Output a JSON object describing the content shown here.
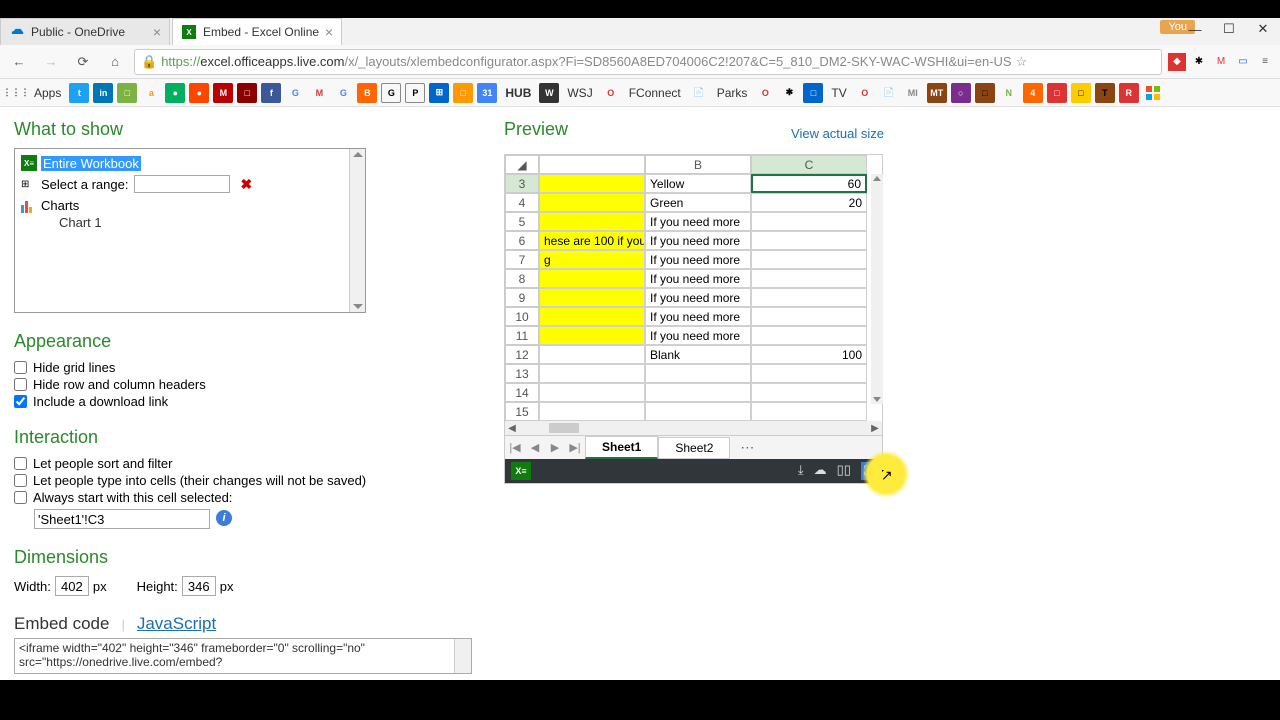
{
  "tabs": [
    {
      "title": "Public - OneDrive",
      "icon_color": "#0078d4"
    },
    {
      "title": "Embed - Excel Online",
      "icon_color": "#107c10"
    }
  ],
  "you_label": "You",
  "url": {
    "scheme": "https://",
    "host": "excel.officeapps.live.com",
    "path": "/x/_layouts/xlembedconfigurator.aspx?Fi=SD8560A8ED704006C2!207&C=5_810_DM2-SKY-WAC-WSHI&ui=en-US"
  },
  "bookmarks": [
    "Apps",
    "t",
    "in",
    "",
    "a",
    "",
    "",
    "M",
    "",
    "G",
    "G",
    "",
    "P",
    "",
    "",
    "31",
    "HUB",
    "W",
    "WSJ",
    "",
    "FConnect",
    "",
    "Parks",
    "O",
    "",
    "",
    "TV",
    "O",
    "",
    "MI",
    "MT",
    "",
    "",
    "N",
    "4",
    "",
    "",
    "",
    "",
    "R",
    ""
  ],
  "sections": {
    "what": "What to show",
    "appearance": "Appearance",
    "interaction": "Interaction",
    "dimensions": "Dimensions",
    "embed": "Embed code",
    "js": "JavaScript",
    "preview": "Preview"
  },
  "what_items": {
    "workbook": "Entire Workbook",
    "range_label": "Select a range:",
    "charts": "Charts",
    "chart1": "Chart 1"
  },
  "appearance_items": {
    "grid": "Hide grid lines",
    "headers": "Hide row and column headers",
    "download": "Include a download link"
  },
  "interaction_items": {
    "sort": "Let people sort and filter",
    "type": "Let people type into cells (their changes will not be saved)",
    "start": "Always start with this cell selected:",
    "cell_value": "'Sheet1'!C3"
  },
  "dimensions_items": {
    "width_label": "Width:",
    "width_value": "402",
    "height_label": "Height:",
    "height_value": "346",
    "px": "px"
  },
  "embed_code": "<iframe width=\"402\" height=\"346\" frameborder=\"0\" scrolling=\"no\" src=\"https://onedrive.live.com/embed?",
  "view_actual": "View actual size",
  "sheet_cols": [
    "",
    "B",
    "C"
  ],
  "chart_data": {
    "type": "table",
    "columns": [
      "row",
      "A_fragment",
      "B",
      "C"
    ],
    "rows": [
      {
        "row": 3,
        "A_fragment": "",
        "B": "Yellow",
        "C": 60
      },
      {
        "row": 4,
        "A_fragment": "",
        "B": "Green",
        "C": 20
      },
      {
        "row": 5,
        "A_fragment": "",
        "B": "If you need more",
        "C": ""
      },
      {
        "row": 6,
        "A_fragment": "hese are 100 if you",
        "B": "If you need more",
        "C": ""
      },
      {
        "row": 7,
        "A_fragment": "g",
        "B": "If you need more",
        "C": ""
      },
      {
        "row": 8,
        "A_fragment": "",
        "B": "If you need more",
        "C": ""
      },
      {
        "row": 9,
        "A_fragment": "",
        "B": "If you need more",
        "C": ""
      },
      {
        "row": 10,
        "A_fragment": "",
        "B": "If you need more",
        "C": ""
      },
      {
        "row": 11,
        "A_fragment": "",
        "B": "If you need more",
        "C": ""
      },
      {
        "row": 12,
        "A_fragment": "",
        "B": "Blank",
        "C": 100
      },
      {
        "row": 13,
        "A_fragment": "",
        "B": "",
        "C": ""
      },
      {
        "row": 14,
        "A_fragment": "",
        "B": "",
        "C": ""
      },
      {
        "row": 15,
        "A_fragment": "",
        "B": "",
        "C": ""
      }
    ]
  },
  "sheets": {
    "s1": "Sheet1",
    "s2": "Sheet2"
  }
}
